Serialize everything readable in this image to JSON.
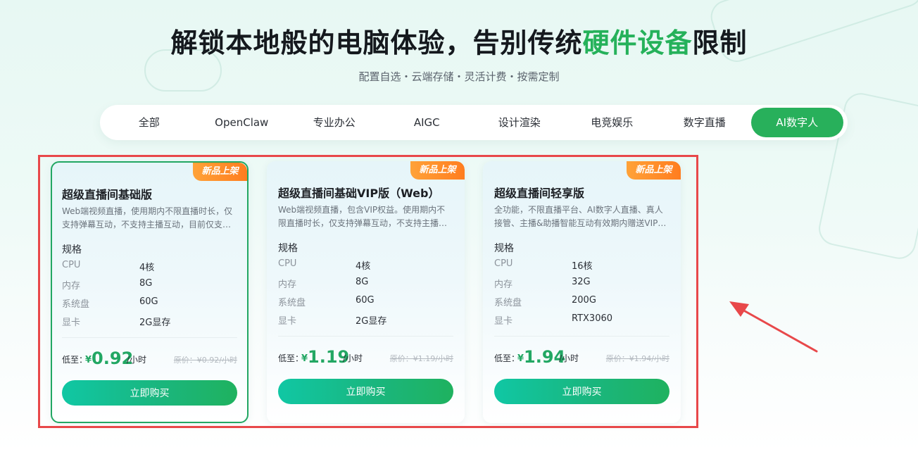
{
  "header": {
    "title_main": "解锁本地般的电脑体验，告别传统",
    "title_highlight": "硬件设备",
    "title_tail": "限制",
    "subtitle": "配置自选・云端存储・灵活计费・按需定制"
  },
  "tabs": [
    {
      "label": "全部"
    },
    {
      "label": "OpenClaw"
    },
    {
      "label": "专业办公"
    },
    {
      "label": "AIGC"
    },
    {
      "label": "设计渲染"
    },
    {
      "label": "电竞娱乐"
    },
    {
      "label": "数字直播"
    },
    {
      "label": "AI数字人",
      "active": true
    }
  ],
  "spec_heading": "规格",
  "spec_keys": {
    "cpu": "CPU",
    "mem": "内存",
    "disk": "系统盘",
    "gpu": "显卡"
  },
  "price_label": "低至：",
  "currency": "¥",
  "price_unit": "/小时",
  "buy_label": "立即购买",
  "cards": [
    {
      "badge": "新品上架",
      "title": "超级直播间基础版",
      "desc": "Web端视频直播，使用期内不限直播时长，仅支持弹幕互动，不支持主播互动，目前仅支…",
      "cpu": "4核",
      "mem": "8G",
      "disk": "60G",
      "gpu": "2G显存",
      "price": "0.92",
      "orig": "原价：¥0.92/小时",
      "selected": true
    },
    {
      "badge": "新品上架",
      "title": "超级直播间基础VIP版（Web）",
      "desc": "Web端视频直播，包含VIP权益。使用期内不限直播时长，仅支持弹幕互动，不支持主播…",
      "cpu": "4核",
      "mem": "8G",
      "disk": "60G",
      "gpu": "2G显存",
      "price": "1.19",
      "orig": "原价：¥1.19/小时"
    },
    {
      "badge": "新品上架",
      "title": "超级直播间轻享版",
      "desc": "全功能，不限直播平台、AI数字人直播、真人接管、主播&助播智能互动有效期内赠送VIP…",
      "cpu": "16核",
      "mem": "32G",
      "disk": "200G",
      "gpu": "RTX3060",
      "price": "1.94",
      "orig": "原价：¥1.94/小时"
    }
  ],
  "colors": {
    "accent": "#25b15a",
    "badge": "#ff8a24",
    "highlight_box": "#e8484a"
  },
  "icons": {
    "arrow": "arrow-pointer-icon"
  }
}
